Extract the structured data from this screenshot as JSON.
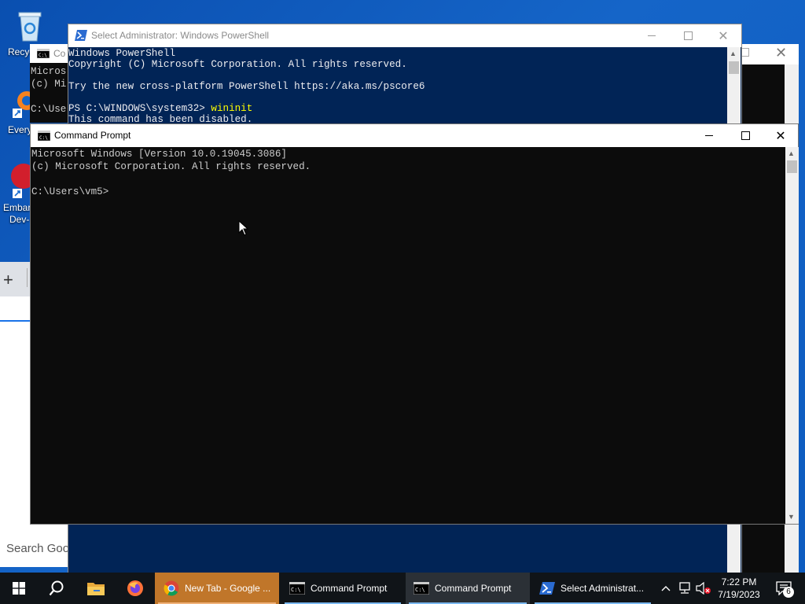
{
  "desktop": {
    "icons": [
      {
        "label": "Recyc",
        "icon": "recycle-bin-icon"
      },
      {
        "label": "Every",
        "icon": "everything-icon"
      },
      {
        "label": "Embar",
        "label2": "Dev-",
        "icon": "embarcadero-icon"
      }
    ]
  },
  "chrome_window": {
    "new_tab_symbol": "+",
    "search_placeholder": "Search Goo"
  },
  "back_cmd_window": {
    "title": "Co",
    "lines": [
      "Micros",
      "(c) Mi",
      "",
      "C:\\Use"
    ]
  },
  "powershell_window": {
    "title": "Select Administrator: Windows PowerShell",
    "lines": [
      "Windows PowerShell",
      "Copyright (C) Microsoft Corporation. All rights reserved.",
      "",
      "Try the new cross-platform PowerShell https://aka.ms/pscore6",
      "",
      "PS C:\\WINDOWS\\system32> ",
      "This command has been disabled."
    ],
    "command": "wininit",
    "colors": {
      "background": "#012456",
      "text": "#eeedf0",
      "command": "#ffff00"
    }
  },
  "cmd_window": {
    "title": "Command Prompt",
    "lines": [
      "Microsoft Windows [Version 10.0.19045.3086]",
      "(c) Microsoft Corporation. All rights reserved.",
      "",
      "C:\\Users\\vm5>"
    ],
    "colors": {
      "background": "#0c0c0c",
      "text": "#cccccc"
    }
  },
  "taskbar": {
    "items": [
      {
        "label": "New Tab - Google ...",
        "icon": "chrome-icon"
      },
      {
        "label": "Command Prompt",
        "icon": "cmd-icon"
      },
      {
        "label": "Command Prompt",
        "icon": "cmd-icon"
      },
      {
        "label": "Select Administrat...",
        "icon": "powershell-icon"
      }
    ],
    "time": "7:22 PM",
    "date": "7/19/2023",
    "notification_count": "6"
  }
}
